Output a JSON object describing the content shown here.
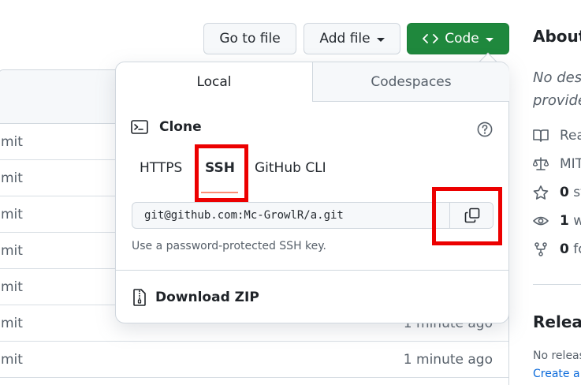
{
  "toolbar": {
    "go_to_file": "Go to file",
    "add_file": "Add file",
    "code": "Code"
  },
  "files": {
    "rows": [
      {
        "message": "mit",
        "time": ""
      },
      {
        "message": "mit",
        "time": ""
      },
      {
        "message": "mit",
        "time": ""
      },
      {
        "message": "mit",
        "time": ""
      },
      {
        "message": "mit",
        "time": ""
      },
      {
        "message": "mit",
        "time": "1 minute ago"
      },
      {
        "message": "mit",
        "time": "1 minute ago"
      }
    ]
  },
  "sidebar": {
    "about_title": "About",
    "description_line1": "No des",
    "description_line2": "provide",
    "readme": "Rea",
    "license": "MIT",
    "stars_count": "0",
    "stars_label": "st",
    "watchers_count": "1",
    "watchers_label": "w",
    "forks_count": "0",
    "forks_label": "fo",
    "releases_title": "Releas",
    "no_releases": "No releas",
    "create_link": "Create a"
  },
  "popover": {
    "tabs": [
      "Local",
      "Codespaces"
    ],
    "active_tab": "Local",
    "clone_title": "Clone",
    "protocols": [
      "HTTPS",
      "SSH",
      "GitHub CLI"
    ],
    "selected_protocol": "SSH",
    "clone_url": "git@github.com:Mc-GrowlR/a.git",
    "ssh_note": "Use a password-protected SSH key.",
    "download_zip": "Download ZIP"
  },
  "colors": {
    "code_button": "#1f883d",
    "tab_underline": "#fd8c73",
    "highlight": "#ec0000",
    "link": "#0969da"
  }
}
